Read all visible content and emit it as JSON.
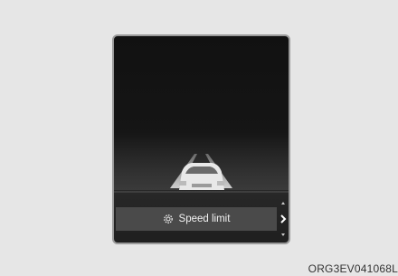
{
  "display": {
    "menu_label": "Speed limit",
    "menu_icon": "gear-icon",
    "next_icon": "chevron-right-icon"
  },
  "caption": {
    "code": "ORG3EV041068L"
  }
}
